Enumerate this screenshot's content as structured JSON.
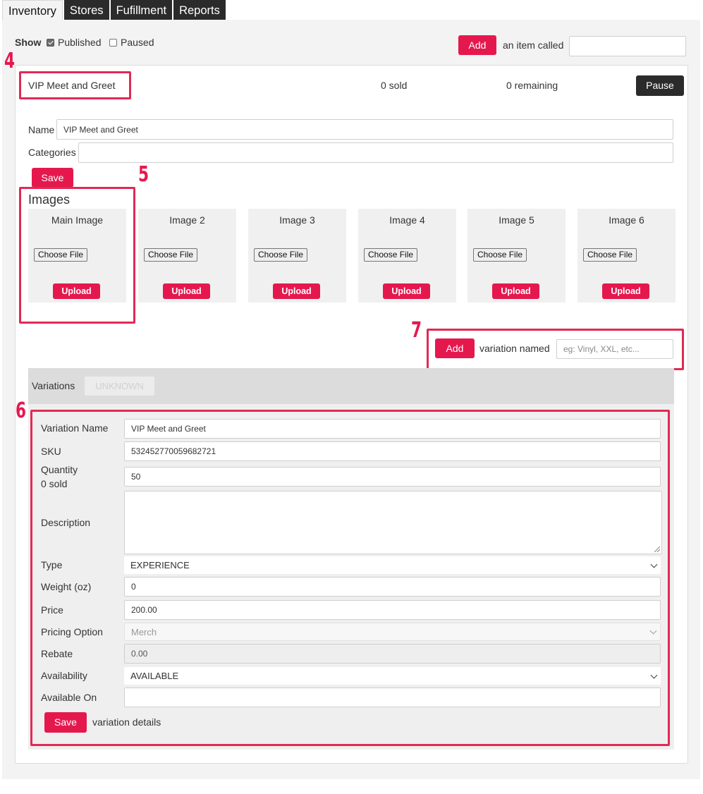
{
  "tabs": [
    "Inventory",
    "Stores",
    "Fufillment",
    "Reports"
  ],
  "filter": {
    "show_label": "Show",
    "published_label": "Published",
    "paused_label": "Paused"
  },
  "add_item": {
    "button_label": "Add",
    "text": "an item called",
    "value": ""
  },
  "item": {
    "name": "VIP Meet and Greet",
    "sold": "0 sold",
    "remaining": "0 remaining",
    "pause_label": "Pause"
  },
  "item_form": {
    "name_label": "Name",
    "name_value": "VIP Meet and Greet",
    "categories_label": "Categories",
    "categories_value": "",
    "save_label": "Save"
  },
  "images": {
    "heading": "Images",
    "slots": [
      {
        "title": "Main Image",
        "choose": "Choose File",
        "upload": "Upload"
      },
      {
        "title": "Image 2",
        "choose": "Choose File",
        "upload": "Upload"
      },
      {
        "title": "Image 3",
        "choose": "Choose File",
        "upload": "Upload"
      },
      {
        "title": "Image 4",
        "choose": "Choose File",
        "upload": "Upload"
      },
      {
        "title": "Image 5",
        "choose": "Choose File",
        "upload": "Upload"
      },
      {
        "title": "Image 6",
        "choose": "Choose File",
        "upload": "Upload"
      }
    ]
  },
  "add_variation": {
    "button_label": "Add",
    "text": "variation named",
    "placeholder": "eg: Vinyl, XXL, etc..."
  },
  "variations": {
    "label": "Variations",
    "tab": "UNKNOWN"
  },
  "variation_form": {
    "name_label": "Variation Name",
    "name_value": "VIP Meet and Greet",
    "sku_label": "SKU",
    "sku_value": "532452770059682721",
    "quantity_label": "Quantity",
    "quantity_sub": "0 sold",
    "quantity_value": "50",
    "description_label": "Description",
    "description_value": "",
    "type_label": "Type",
    "type_value": "EXPERIENCE",
    "weight_label": "Weight (oz)",
    "weight_value": "0",
    "price_label": "Price",
    "price_value": "200.00",
    "pricing_option_label": "Pricing Option",
    "pricing_option_value": "Merch",
    "rebate_label": "Rebate",
    "rebate_value": "0.00",
    "availability_label": "Availability",
    "availability_value": "AVAILABLE",
    "available_on_label": "Available On",
    "available_on_value": "",
    "save_label": "Save",
    "save_text": "variation details"
  },
  "annotations": [
    "4",
    "5",
    "6",
    "7"
  ],
  "colors": {
    "accent": "#e5184e",
    "highlight": "#e02a55",
    "dark_button": "#2b2b2b"
  }
}
